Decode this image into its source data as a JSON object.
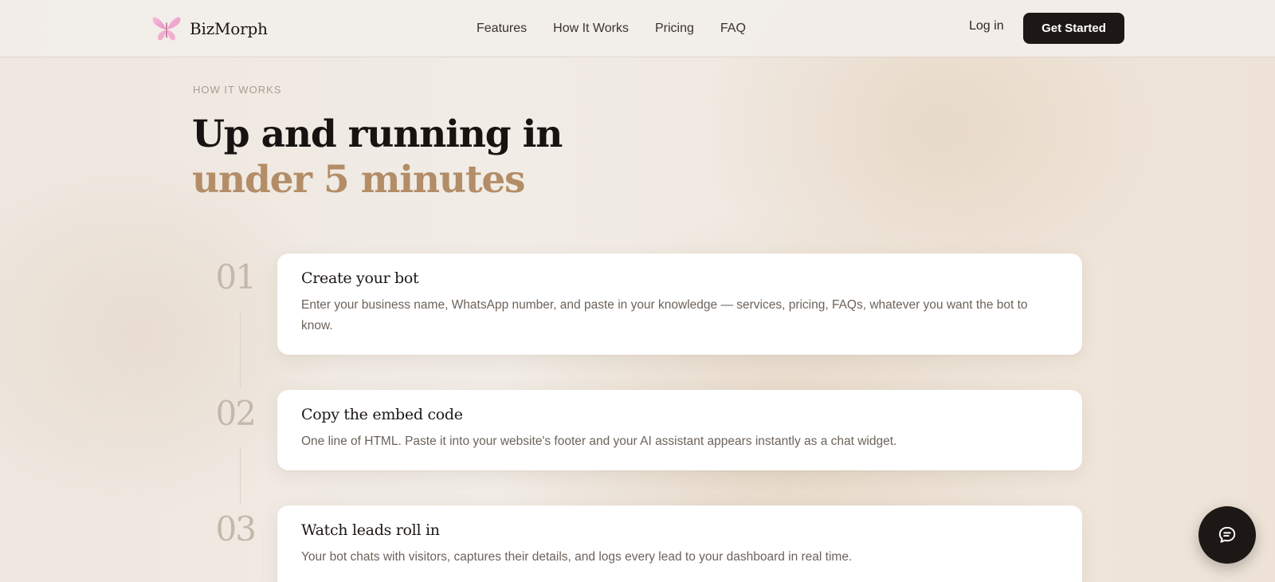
{
  "header": {
    "brand": "BizMorph",
    "logo_icon": "butterfly-icon",
    "nav": [
      "Features",
      "How It Works",
      "Pricing",
      "FAQ"
    ],
    "login_label": "Log in",
    "cta_label": "Get Started"
  },
  "section": {
    "eyebrow": "HOW IT WORKS",
    "headline_line1": "Up and running in",
    "headline_line2": "under 5 minutes",
    "accent_color": "#b38d67"
  },
  "steps": [
    {
      "number": "01",
      "title": "Create your bot",
      "text": "Enter your business name, WhatsApp number, and paste in your knowledge — services, pricing, FAQs, whatever you want the bot to know."
    },
    {
      "number": "02",
      "title": "Copy the embed code",
      "text": "One line of HTML. Paste it into your website's footer and your AI assistant appears instantly as a chat widget."
    },
    {
      "number": "03",
      "title": "Watch leads roll in",
      "text": "Your bot chats with visitors, captures their details, and logs every lead to your dashboard in real time."
    }
  ],
  "chat_widget": {
    "icon": "chat-bubble-icon"
  }
}
